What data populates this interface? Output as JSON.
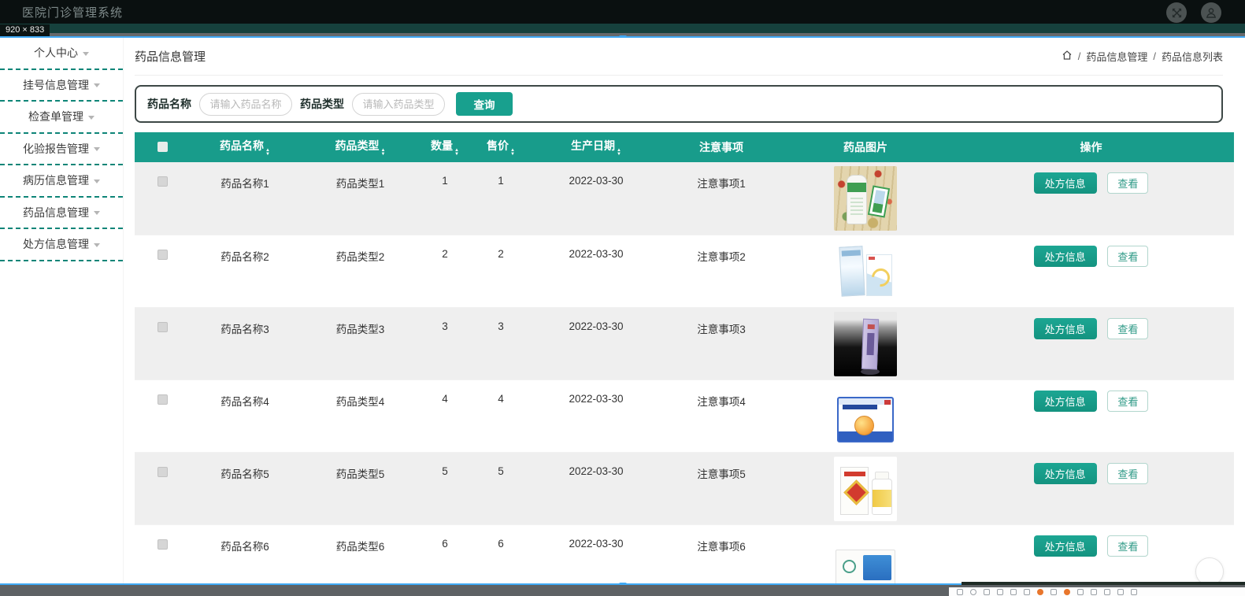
{
  "topbar": {
    "title": "医院门诊管理系统"
  },
  "rdm": {
    "size_label": "920 × 833"
  },
  "sidebar": {
    "items": [
      {
        "label": "个人中心"
      },
      {
        "label": "挂号信息管理"
      },
      {
        "label": "检查单管理"
      },
      {
        "label": "化验报告管理"
      },
      {
        "label": "病历信息管理"
      },
      {
        "label": "药品信息管理"
      },
      {
        "label": "处方信息管理"
      }
    ]
  },
  "page": {
    "title": "药品信息管理",
    "breadcrumb": {
      "separator": "/",
      "items": [
        "药品信息管理",
        "药品信息列表"
      ]
    }
  },
  "search": {
    "name_label": "药品名称",
    "name_placeholder": "请输入药品名称",
    "type_label": "药品类型",
    "type_placeholder": "请输入药品类型",
    "submit_label": "查询"
  },
  "table": {
    "headers": [
      {
        "label": "药品名称",
        "sortable": true
      },
      {
        "label": "药品类型",
        "sortable": true
      },
      {
        "label": "数量",
        "sortable": true
      },
      {
        "label": "售价",
        "sortable": true
      },
      {
        "label": "生产日期",
        "sortable": true
      },
      {
        "label": "注意事项",
        "sortable": false
      },
      {
        "label": "药品图片",
        "sortable": false
      },
      {
        "label": "操作",
        "sortable": false
      }
    ],
    "actions": {
      "primary": "处方信息",
      "secondary": "查看"
    },
    "rows": [
      {
        "name": "药品名称1",
        "type": "药品类型1",
        "quantity": "1",
        "price": "1",
        "date": "2022-03-30",
        "note": "注意事项1",
        "image": "green-bottle"
      },
      {
        "name": "药品名称2",
        "type": "药品类型2",
        "quantity": "2",
        "price": "2",
        "date": "2022-03-30",
        "note": "注意事项2",
        "image": "blue-box-sachet"
      },
      {
        "name": "药品名称3",
        "type": "药品类型3",
        "quantity": "3",
        "price": "3",
        "date": "2022-03-30",
        "note": "注意事项3",
        "image": "purple-box-dark"
      },
      {
        "name": "药品名称4",
        "type": "药品类型4",
        "quantity": "4",
        "price": "4",
        "date": "2022-03-30",
        "note": "注意事项4",
        "image": "kids-blue-box"
      },
      {
        "name": "药品名称5",
        "type": "药品类型5",
        "quantity": "5",
        "price": "5",
        "date": "2022-03-30",
        "note": "注意事项5",
        "image": "vc-box-bottle"
      },
      {
        "name": "药品名称6",
        "type": "药品类型6",
        "quantity": "6",
        "price": "6",
        "date": "2022-03-30",
        "note": "注意事项6",
        "image": "blue-panel-box"
      }
    ]
  },
  "taskbar": {
    "icons": [
      "window",
      "circle",
      "frame",
      "arrow",
      "pen",
      "grid",
      "dot-orange",
      "rect",
      "pin-orange",
      "cursor",
      "bar",
      "chevron",
      "box",
      "dots"
    ]
  },
  "colors": {
    "accent_teal": "#18a08e",
    "header_teal": "#189c8b",
    "dash_teal": "#0e8578",
    "rdm_blue": "#3fa9f5",
    "taskbar_orange": "#e8762c",
    "navbar_bg": "#0a1010"
  }
}
